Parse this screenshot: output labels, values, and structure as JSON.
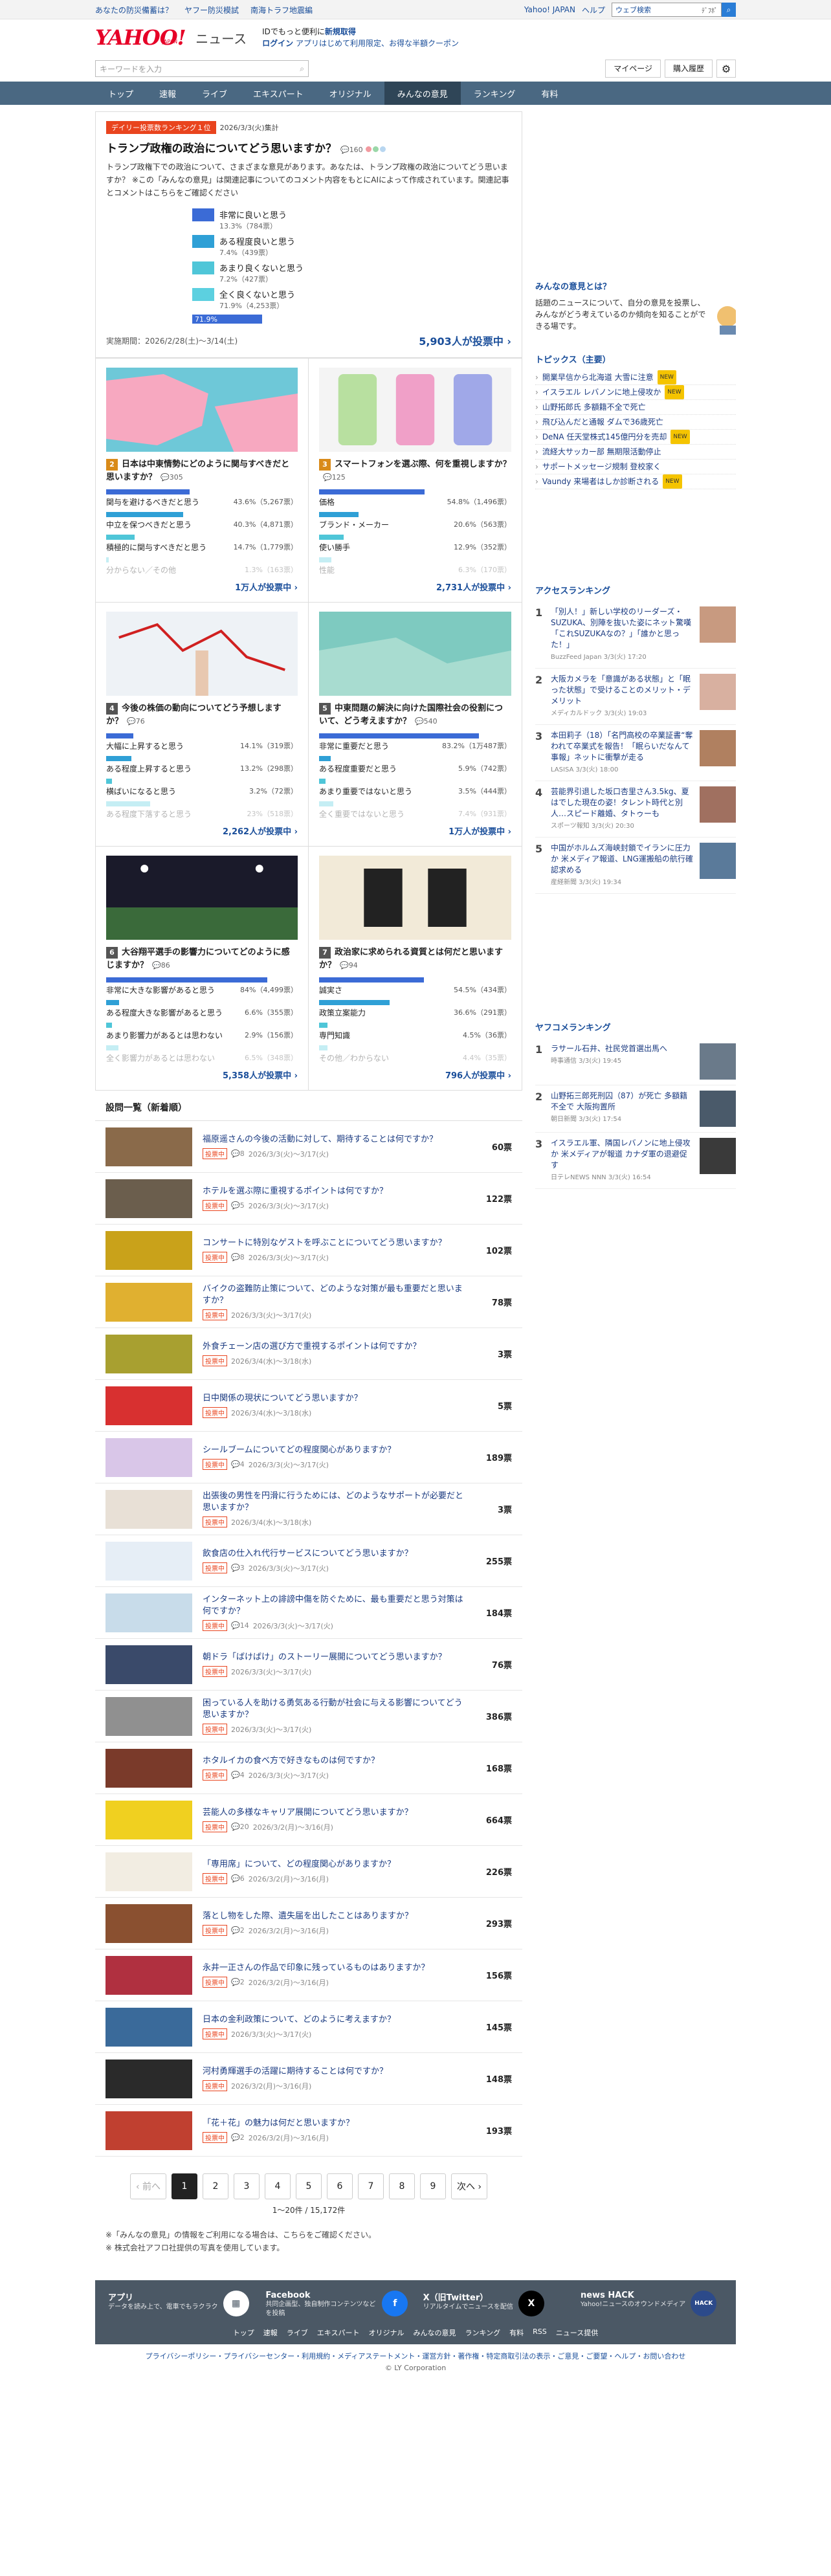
{
  "top": {
    "left_links": [
      "あなたの防災備蓄は？",
      "ヤフー防災模試",
      "南海トラフ地震編"
    ],
    "right_links": [
      "Yahoo! JAPAN",
      "ヘルプ"
    ],
    "search_placeholder": "ウェブ検索",
    "search_btn": "ﾃﾞﾌﾎﾟ"
  },
  "header": {
    "logo": "YAHOO!",
    "logo_sub": "JAPAN",
    "section": "ニュース",
    "promo_line1_a": "IDでもっと便利に",
    "promo_line1_b": "新規取得",
    "promo_line2_a": "ログイン",
    "promo_line2_b": "アプリはじめて利用限定、お得な半額クーポン"
  },
  "searchbar": {
    "placeholder": "キーワードを入力",
    "mypage": "マイページ",
    "history": "購入履歴"
  },
  "nav": [
    "トップ",
    "速報",
    "ライブ",
    "エキスパート",
    "オリジナル",
    "みんなの意見",
    "ランキング",
    "有料"
  ],
  "featured": {
    "badge": "デイリー投票数ランキング１位",
    "date": "2026/3/3(火)集計",
    "title": "トランプ政権の政治についてどう思いますか？",
    "comments": "160",
    "desc": "トランプ政権下での政治について、さまざまな意見があります。あなたは、トランプ政権の政治についてどう思いますか？ ※この「みんなの意見」は関連記事についてのコメント内容をもとにAIによって作成されています。関連記事とコメントはこちらをご確認ください",
    "options": [
      {
        "label": "非常に良いと思う",
        "pct": "13.3%（784票）",
        "color": "#3b6bd6"
      },
      {
        "label": "ある程度良いと思う",
        "pct": "7.4%（439票）",
        "color": "#2fa0d6"
      },
      {
        "label": "あまり良くないと思う",
        "pct": "7.2%（427票）",
        "color": "#4fc6d8"
      },
      {
        "label": "全く良くないと思う",
        "pct": "71.9%（4,253票）",
        "color": "#5cd0e0"
      }
    ],
    "top_share": 71.9,
    "top_share_label": "71.9%",
    "period": "実施期間：2026/2/28(土)〜3/14(土)",
    "votes": "5,903人が投票中"
  },
  "cards": [
    {
      "no": "2",
      "num_color": "#d98b1a",
      "img": "map1",
      "title": "日本は中東情勢にどのように関与すべきだと思いますか？",
      "comments": "305",
      "rows": [
        {
          "label": "関与を避けるべきだと思う",
          "pct": "43.6%（5,267票）",
          "share": 43.6,
          "color": "#3b6bd6"
        },
        {
          "label": "中立を保つべきだと思う",
          "pct": "40.3%（4,871票）",
          "share": 40.3,
          "color": "#2fa0d6"
        },
        {
          "label": "積極的に関与すべきだと思う",
          "pct": "14.7%（1,779票）",
          "share": 14.7,
          "color": "#4fc6d8"
        },
        {
          "label": "分からない／その他",
          "pct": "1.3%（163票）",
          "share": 1.3,
          "color": "#5cd0e0"
        }
      ],
      "votes": "1万人が投票中"
    },
    {
      "no": "3",
      "num_color": "#d98b1a",
      "img": "phones",
      "title": "スマートフォンを選ぶ際、何を重視しますか？",
      "comments": "125",
      "rows": [
        {
          "label": "価格",
          "pct": "54.8%（1,496票）",
          "share": 54.8,
          "color": "#3b6bd6"
        },
        {
          "label": "ブランド・メーカー",
          "pct": "20.6%（563票）",
          "share": 20.6,
          "color": "#2fa0d6"
        },
        {
          "label": "使い勝手",
          "pct": "12.9%（352票）",
          "share": 12.9,
          "color": "#4fc6d8"
        },
        {
          "label": "性能",
          "pct": "6.3%（170票）",
          "share": 6.3,
          "color": "#5cd0e0"
        }
      ],
      "votes": "2,731人が投票中"
    },
    {
      "no": "4",
      "num_color": "#555",
      "img": "stock",
      "title": "今後の株価の動向についてどう予想しますか？",
      "comments": "76",
      "rows": [
        {
          "label": "大幅に上昇すると思う",
          "pct": "14.1%（319票）",
          "share": 14.1,
          "color": "#3b6bd6"
        },
        {
          "label": "ある程度上昇すると思う",
          "pct": "13.2%（298票）",
          "share": 13.2,
          "color": "#2fa0d6"
        },
        {
          "label": "横ばいになると思う",
          "pct": "3.2%（72票）",
          "share": 3.2,
          "color": "#4fc6d8"
        },
        {
          "label": "ある程度下落すると思う",
          "pct": "23%（518票）",
          "share": 23.0,
          "color": "#5cd0e0"
        }
      ],
      "votes": "2,262人が投票中"
    },
    {
      "no": "5",
      "num_color": "#555",
      "img": "map2",
      "title": "中東問題の解決に向けた国際社会の役割について、どう考えますか？",
      "comments": "540",
      "rows": [
        {
          "label": "非常に重要だと思う",
          "pct": "83.2%（1万487票）",
          "share": 83.2,
          "color": "#3b6bd6"
        },
        {
          "label": "ある程度重要だと思う",
          "pct": "5.9%（742票）",
          "share": 5.9,
          "color": "#2fa0d6"
        },
        {
          "label": "あまり重要ではないと思う",
          "pct": "3.5%（444票）",
          "share": 3.5,
          "color": "#4fc6d8"
        },
        {
          "label": "全く重要ではないと思う",
          "pct": "7.4%（931票）",
          "share": 7.4,
          "color": "#5cd0e0"
        }
      ],
      "votes": "1万人が投票中"
    },
    {
      "no": "6",
      "num_color": "#555",
      "img": "stadium",
      "title": "大谷翔平選手の影響力についてどのように感じますか？",
      "comments": "86",
      "rows": [
        {
          "label": "非常に大きな影響があると思う",
          "pct": "84%（4,499票）",
          "share": 84,
          "color": "#3b6bd6"
        },
        {
          "label": "ある程度大きな影響があると思う",
          "pct": "6.6%（355票）",
          "share": 6.6,
          "color": "#2fa0d6"
        },
        {
          "label": "あまり影響力があるとは思わない",
          "pct": "2.9%（156票）",
          "share": 2.9,
          "color": "#4fc6d8"
        },
        {
          "label": "全く影響力があるとは思わない",
          "pct": "6.5%（348票）",
          "share": 6.5,
          "color": "#5cd0e0"
        }
      ],
      "votes": "5,358人が投票中"
    },
    {
      "no": "7",
      "num_color": "#555",
      "img": "kanji",
      "title": "政治家に求められる資質とは何だと思いますか？",
      "comments": "94",
      "rows": [
        {
          "label": "誠実さ",
          "pct": "54.5%（434票）",
          "share": 54.5,
          "color": "#3b6bd6"
        },
        {
          "label": "政策立案能力",
          "pct": "36.6%（291票）",
          "share": 36.6,
          "color": "#2fa0d6"
        },
        {
          "label": "専門知識",
          "pct": "4.5%（36票）",
          "share": 4.5,
          "color": "#4fc6d8"
        },
        {
          "label": "その他／わからない",
          "pct": "4.4%（35票）",
          "share": 4.4,
          "color": "#5cd0e0"
        }
      ],
      "votes": "796人が投票中"
    }
  ],
  "list_heading": "設問一覧（新着順）",
  "list_tag": "投票中",
  "list": [
    {
      "title": "福原遥さんの今後の活動に対して、期待することは何ですか？",
      "meta": "2026/3/3(火)〜3/17(火)",
      "c": "8",
      "votes": "60票",
      "thumb": "#8a6a4a"
    },
    {
      "title": "ホテルを選ぶ際に重視するポイントは何ですか？",
      "meta": "2026/3/3(火)〜3/17(火)",
      "c": "5",
      "votes": "122票",
      "thumb": "#6b5e4d"
    },
    {
      "title": "コンサートに特別なゲストを呼ぶことについてどう思いますか？",
      "meta": "2026/3/3(火)〜3/17(火)",
      "c": "8",
      "votes": "102票",
      "thumb": "#c9a21a"
    },
    {
      "title": "バイクの盗難防止策について、どのような対策が最も重要だと思いますか？",
      "meta": "2026/3/3(火)〜3/17(火)",
      "c": "",
      "votes": "78票",
      "thumb": "#e0b030"
    },
    {
      "title": "外食チェーン店の選び方で重視するポイントは何ですか？",
      "meta": "2026/3/4(水)〜3/18(水)",
      "c": "",
      "votes": "3票",
      "thumb": "#a8a030"
    },
    {
      "title": "日中関係の現状についてどう思いますか？",
      "meta": "2026/3/4(水)〜3/18(水)",
      "c": "",
      "votes": "5票",
      "thumb": "#d83030"
    },
    {
      "title": "シールブームについてどの程度関心がありますか？",
      "meta": "2026/3/3(火)〜3/17(火)",
      "c": "4",
      "votes": "189票",
      "thumb": "#d9c6e8"
    },
    {
      "title": "出張後の男性を円滑に行うためには、どのようなサポートが必要だと思いますか？",
      "meta": "2026/3/4(水)〜3/18(水)",
      "c": "",
      "votes": "3票",
      "thumb": "#e8e0d6"
    },
    {
      "title": "飲食店の仕入れ代行サービスについてどう思いますか？",
      "meta": "2026/3/3(火)〜3/17(火)",
      "c": "3",
      "votes": "255票",
      "thumb": "#e6eef6"
    },
    {
      "title": "インターネット上の誹謗中傷を防ぐために、最も重要だと思う対策は何ですか？",
      "meta": "2026/3/3(火)〜3/17(火)",
      "c": "14",
      "votes": "184票",
      "thumb": "#c8dcea"
    },
    {
      "title": "朝ドラ「ばけばけ」のストーリー展開についてどう思いますか？",
      "meta": "2026/3/3(火)〜3/17(火)",
      "c": "",
      "votes": "76票",
      "thumb": "#3a4a6a"
    },
    {
      "title": "困っている人を助ける勇気ある行動が社会に与える影響についてどう思いますか？",
      "meta": "2026/3/3(火)〜3/17(火)",
      "c": "",
      "votes": "386票",
      "thumb": "#909090"
    },
    {
      "title": "ホタルイカの食べ方で好きなものは何ですか？",
      "meta": "2026/3/3(火)〜3/17(火)",
      "c": "4",
      "votes": "168票",
      "thumb": "#7a3a2a"
    },
    {
      "title": "芸能人の多様なキャリア展開についてどう思いますか？",
      "meta": "2026/3/2(月)〜3/16(月)",
      "c": "20",
      "votes": "664票",
      "thumb": "#f0d020"
    },
    {
      "title": "「専用席」について、どの程度関心がありますか？",
      "meta": "2026/3/2(月)〜3/16(月)",
      "c": "6",
      "votes": "226票",
      "thumb": "#f2ede2"
    },
    {
      "title": "落とし物をした際、遺失届を出したことはありますか？",
      "meta": "2026/3/2(月)〜3/16(月)",
      "c": "2",
      "votes": "293票",
      "thumb": "#8a5030"
    },
    {
      "title": "永井一正さんの作品で印象に残っているものはありますか？",
      "meta": "2026/3/2(月)〜3/16(月)",
      "c": "2",
      "votes": "156票",
      "thumb": "#b03040"
    },
    {
      "title": "日本の金利政策について、どのように考えますか？",
      "meta": "2026/3/3(火)〜3/17(火)",
      "c": "",
      "votes": "145票",
      "thumb": "#3a6a9a"
    },
    {
      "title": "河村勇輝選手の活躍に期待することは何ですか？",
      "meta": "2026/3/2(月)〜3/16(月)",
      "c": "",
      "votes": "148票",
      "thumb": "#2a2a2a"
    },
    {
      "title": "「花＋花」の魅力は何だと思いますか？",
      "meta": "2026/3/2(月)〜3/16(月)",
      "c": "2",
      "votes": "193票",
      "thumb": "#c04030"
    }
  ],
  "pager": {
    "prev": "‹ 前へ",
    "pages": [
      "1",
      "2",
      "3",
      "4",
      "5",
      "6",
      "7",
      "8",
      "9"
    ],
    "next": "次へ ›",
    "count": "1〜20件 / 15,172件"
  },
  "notes": [
    "※「みんなの意見」の情報をご利用になる場合は、こちらをご確認ください。",
    "※ 株式会社アフロ社提供の写真を使用しています。"
  ],
  "side": {
    "vote_head": "みんなの意見とは？",
    "vote_desc": "話題のニュースについて、自分の意見を投票し、みんながどう考えているのか傾向を知ることができる場です。",
    "topics_head": "トピックス（主要）",
    "topics": [
      "開業早信から北海道 大雪に注意",
      "イスラエル レバノンに地上侵攻か",
      "山野拓郎氏 多額籍不全で死亡",
      "飛び込んだと通報 ダムで36歳死亡",
      "DeNA 任天堂株式145億円分を売却",
      "流経大サッカー部 無期限活動停止",
      "サポートメッセージ規制 登校家く",
      "Vaundy 来場者はしか診断される"
    ],
    "topics_new": [
      true,
      true,
      false,
      false,
      true,
      false,
      false,
      true
    ],
    "access_head": "アクセスランキング",
    "access": [
      {
        "t": "「別人！」新しい学校のリーダーズ・SUZUKA、別陣を抜いた姿にネット驚嘆「これSUZUKAなの？」「誰かと思った！」",
        "s": "BuzzFeed Japan 3/3(火) 17:20",
        "pic": "#c89a80"
      },
      {
        "t": "大阪カメラを「意識がある状態」と「眠った状態」で受けることのメリット・デメリット",
        "s": "メディカルドック 3/3(火) 19:03",
        "pic": "#d8b0a0"
      },
      {
        "t": "本田莉子（18）「名門高校の卒業証書“奪われて卒業式を報告！「眠らいだなんて事報」ネットに衝撃が走る",
        "s": "LASISA 3/3(火) 18:00",
        "pic": "#b08060"
      },
      {
        "t": "芸能界引退した坂口杏里さん3.5kg、夏はでした現在の姿！タレント時代と別人…スピード離婚、タトゥーも",
        "s": "スポーツ報知 3/3(火) 20:30",
        "pic": "#a07060"
      },
      {
        "t": "中国がホルムズ海峡封鎖でイランに圧力か 米メディア報道、LNG運搬船の航行確認求める",
        "s": "産経新聞 3/3(火) 19:34",
        "pic": "#5a7a9a"
      }
    ],
    "yafo_head": "ヤフコメランキング",
    "yafo": [
      {
        "t": "ラサール石井、社民党首選出馬へ",
        "s": "時事通信 3/3(火) 19:45",
        "pic": "#6a7a8a"
      },
      {
        "t": "山野拓三郎死刑囚（87）が死亡 多額籍不全で 大阪拘置所",
        "s": "朝日新聞 3/3(火) 17:54",
        "pic": "#4a5a6a"
      },
      {
        "t": "イスラエル軍、隣国レバノンに地上侵攻か 米メディアが報道 カナダ軍の退避促す",
        "s": "日テレNEWS NNN 3/3(火) 16:54",
        "pic": "#3a3a3a"
      }
    ]
  },
  "footer": {
    "cols": [
      {
        "t": "アプリ",
        "d": "データを読み上で、電車でもラクラク"
      },
      {
        "t": "Facebook",
        "d": "共同企画型、独自制作コンテンツなどを投稿"
      },
      {
        "t": "X（旧Twitter）",
        "d": "リアルタイムでニュースを配信"
      },
      {
        "t": "news HACK",
        "d": "Yahoo!ニュースのオウンドメディア"
      }
    ],
    "links": [
      "トップ",
      "速報",
      "ライブ",
      "エキスパート",
      "オリジナル",
      "みんなの意見",
      "ランキング",
      "有料",
      "RSS",
      "ニュース提供"
    ],
    "legal": "プライバシーポリシー・プライバシーセンター・利用規約・メディアステートメント・運営方針・著作権・特定商取引法の表示・ご意見・ご要望・ヘルプ・お問い合わせ",
    "copy": "© LY Corporation"
  }
}
